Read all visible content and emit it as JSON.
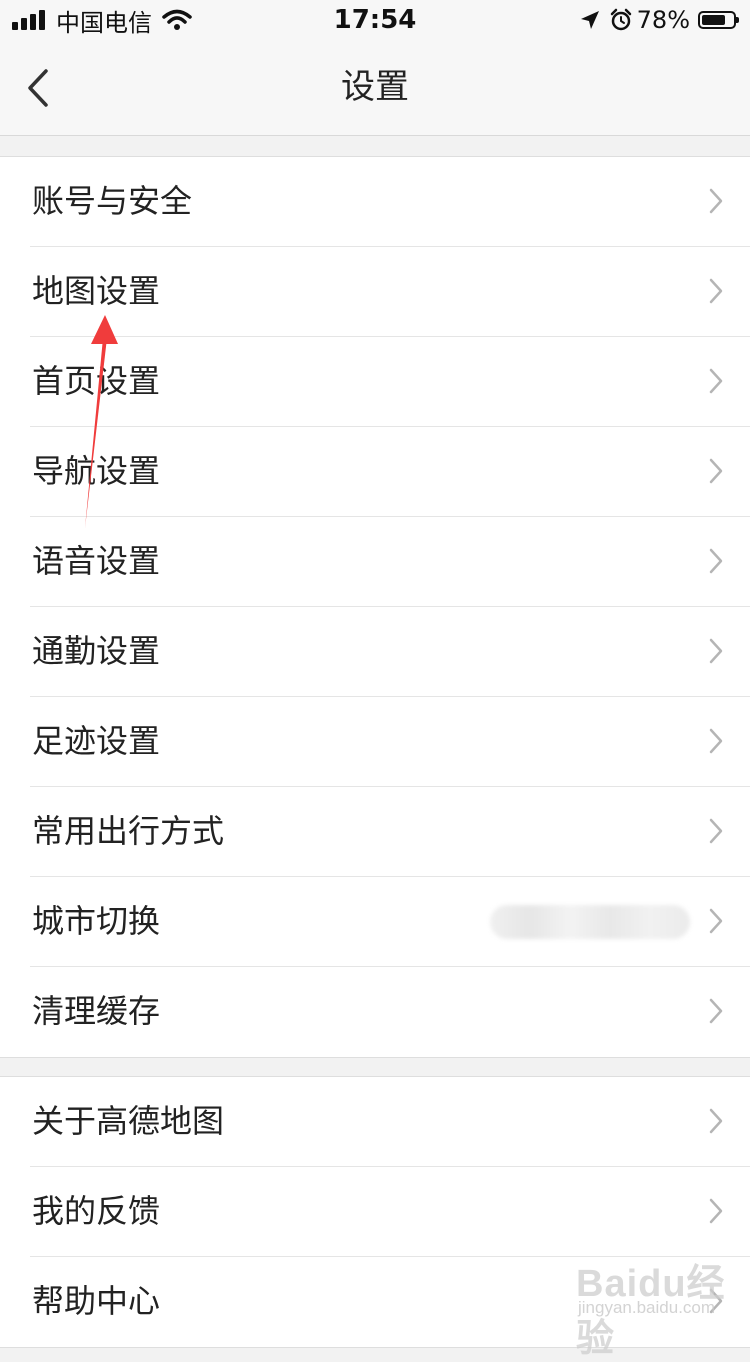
{
  "status_bar": {
    "carrier": "中国电信",
    "time": "17:54",
    "battery_percent": "78%",
    "battery_level": 0.78
  },
  "nav": {
    "title": "设置",
    "back_icon": "chevron-left-icon"
  },
  "settings_group_1": [
    {
      "label": "账号与安全"
    },
    {
      "label": "地图设置"
    },
    {
      "label": "首页设置"
    },
    {
      "label": "导航设置"
    },
    {
      "label": "语音设置"
    },
    {
      "label": "通勤设置"
    },
    {
      "label": "足迹设置"
    },
    {
      "label": "常用出行方式"
    },
    {
      "label": "城市切换"
    },
    {
      "label": "清理缓存"
    }
  ],
  "settings_group_2": [
    {
      "label": "关于高德地图"
    },
    {
      "label": "我的反馈"
    },
    {
      "label": "帮助中心"
    }
  ],
  "watermark": {
    "brand": "Baidu经验",
    "site": "jingyan.baidu.com"
  },
  "colors": {
    "annotation_arrow": "#f03c3c",
    "background": "#f2f2f2",
    "row_background": "#ffffff",
    "chevron": "#b5b5b5"
  }
}
